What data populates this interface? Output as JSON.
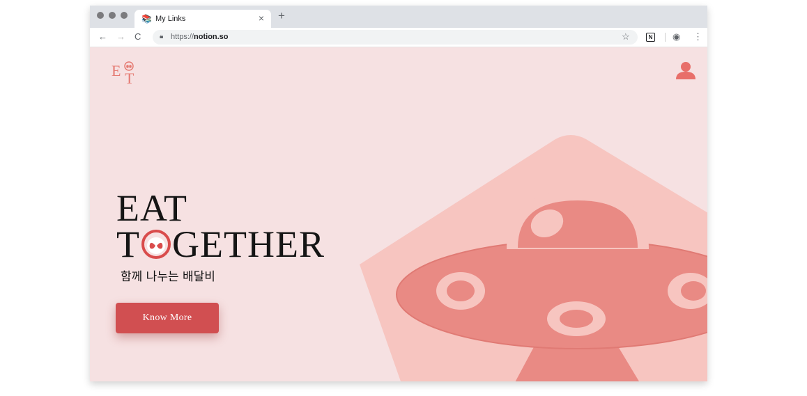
{
  "browser": {
    "tab": {
      "favicon": "books-favicon",
      "title": "My Links",
      "close": "×"
    },
    "new_tab": "+",
    "nav": {
      "back": "←",
      "forward": "→",
      "reload": "C"
    },
    "url_prefix": "https://",
    "url_host": "notion.so",
    "toolbar_icons": {
      "bookmark": "☆",
      "notion": "N",
      "account": "◉",
      "menu": "⋮"
    }
  },
  "page": {
    "logo_text": {
      "e": "E",
      "t": "T"
    },
    "hero": {
      "line1": "EAT",
      "line2_start": "T",
      "line2_end": "GETHER",
      "subtitle": "함께 나누는 배달비"
    },
    "cta_label": "Know More"
  },
  "colors": {
    "page_bg": "#f6e1e2",
    "accent": "#d14f51",
    "ufo_dark": "#e98a84",
    "ufo_light": "#f7c5c0"
  }
}
